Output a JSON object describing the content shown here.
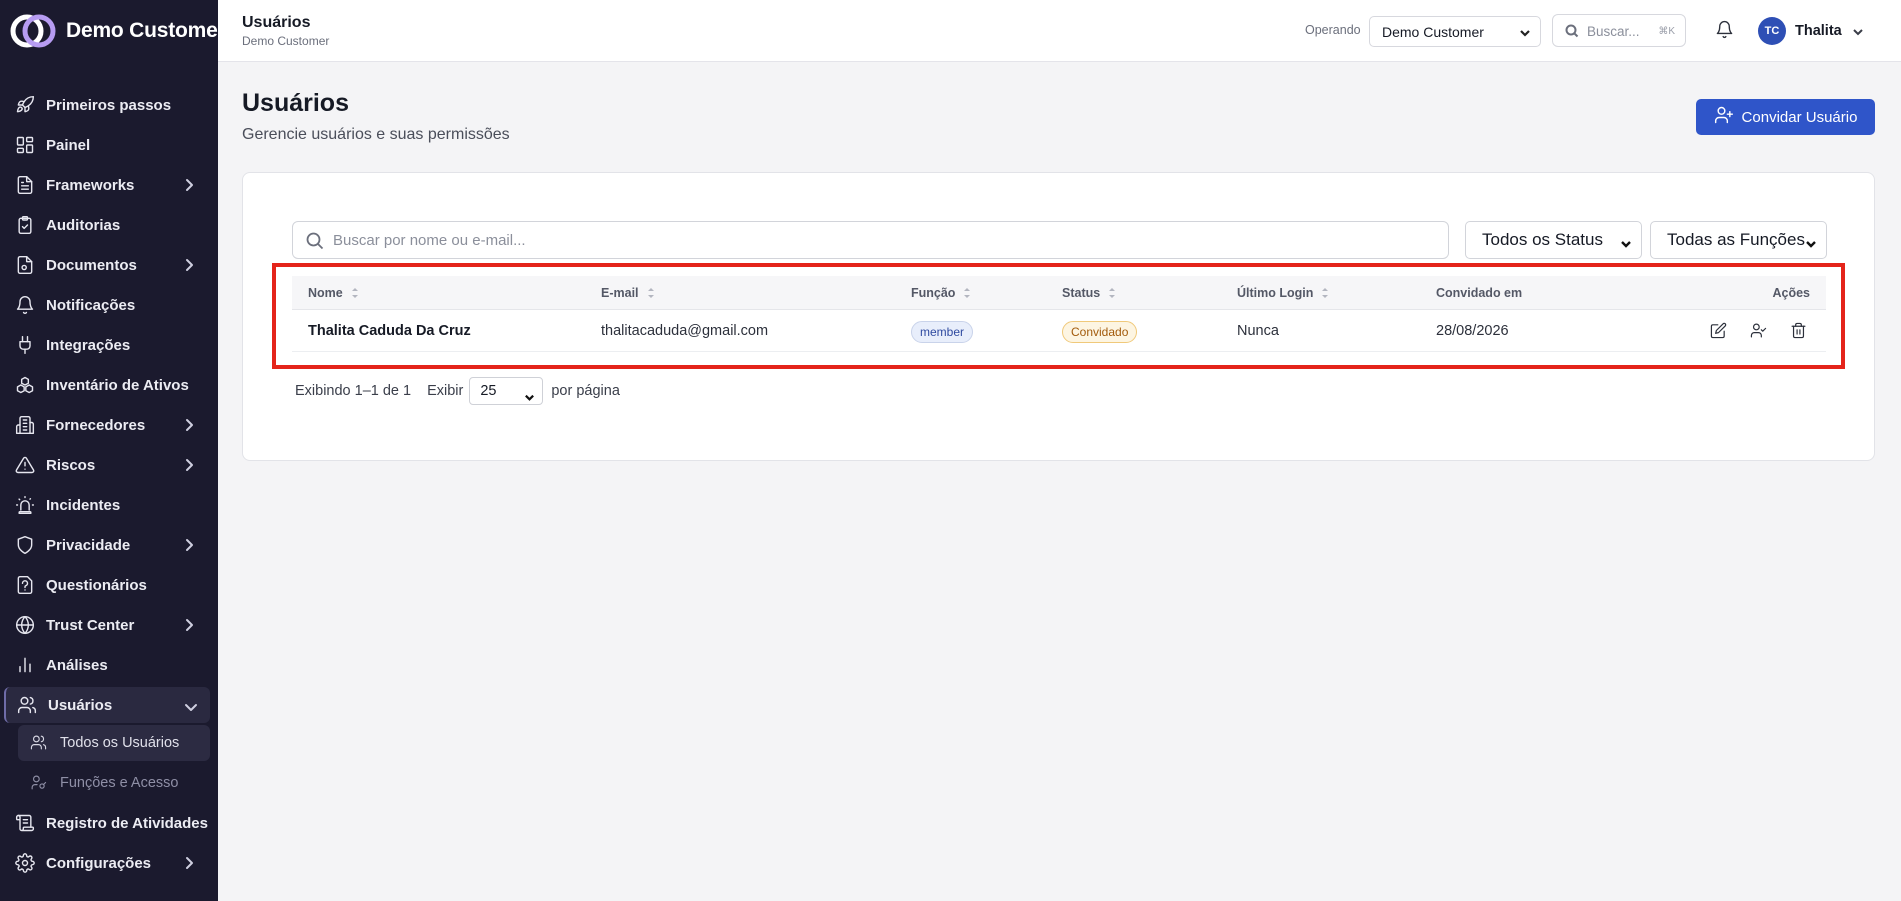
{
  "brand": {
    "name": "Demo Customer"
  },
  "sidebar": {
    "items": [
      {
        "label": "Primeiros passos",
        "icon": "rocket-icon",
        "expandable": false
      },
      {
        "label": "Painel",
        "icon": "dashboard-icon",
        "expandable": false
      },
      {
        "label": "Frameworks",
        "icon": "document-icon",
        "expandable": true
      },
      {
        "label": "Auditorias",
        "icon": "clipboard-check-icon",
        "expandable": false
      },
      {
        "label": "Documentos",
        "icon": "file-icon",
        "expandable": true
      },
      {
        "label": "Notificações",
        "icon": "bell-icon",
        "expandable": false
      },
      {
        "label": "Integrações",
        "icon": "plug-icon",
        "expandable": false
      },
      {
        "label": "Inventário de Ativos",
        "icon": "boxes-icon",
        "expandable": false
      },
      {
        "label": "Fornecedores",
        "icon": "building-icon",
        "expandable": true
      },
      {
        "label": "Riscos",
        "icon": "warning-icon",
        "expandable": true
      },
      {
        "label": "Incidentes",
        "icon": "siren-icon",
        "expandable": false
      },
      {
        "label": "Privacidade",
        "icon": "shield-icon",
        "expandable": true
      },
      {
        "label": "Questionários",
        "icon": "questionnaire-icon",
        "expandable": false
      },
      {
        "label": "Trust Center",
        "icon": "globe-icon",
        "expandable": true
      },
      {
        "label": "Análises",
        "icon": "bar-chart-icon",
        "expandable": false
      },
      {
        "label": "Usuários",
        "icon": "users-icon",
        "expandable": true,
        "expanded": true
      },
      {
        "label": "Registro de Atividades",
        "icon": "log-icon",
        "expandable": false
      },
      {
        "label": "Configurações",
        "icon": "gear-icon",
        "expandable": true
      }
    ],
    "sub_items": [
      {
        "label": "Todos os Usuários",
        "icon": "users-icon"
      },
      {
        "label": "Funções e Acesso",
        "icon": "user-key-icon"
      }
    ]
  },
  "header": {
    "title": "Usuários",
    "subtitle": "Demo Customer",
    "operando_label": "Operando",
    "operando_value": "Demo Customer",
    "search_placeholder": "Buscar...",
    "search_shortcut": "⌘K",
    "user_initials": "TC",
    "user_name": "Thalita"
  },
  "page": {
    "title": "Usuários",
    "subtitle": "Gerencie usuários e suas permissões",
    "invite_label": "Convidar Usuário"
  },
  "filters": {
    "search_placeholder": "Buscar por nome ou e-mail...",
    "status_value": "Todos os Status",
    "role_value": "Todas as Funções"
  },
  "table": {
    "columns": [
      "Nome",
      "E-mail",
      "Função",
      "Status",
      "Último Login",
      "Convidado em",
      "Ações"
    ],
    "rows": [
      {
        "name": "Thalita Caduda Da Cruz",
        "email": "thalitacaduda@gmail.com",
        "role": "member",
        "status": "Convidado",
        "last_login": "Nunca",
        "invited_at": "28/08/2026"
      }
    ]
  },
  "pagination": {
    "summary": "Exibindo 1–1 de 1",
    "show_label": "Exibir",
    "page_size": "25",
    "per_page_label": "por página"
  },
  "colors": {
    "sidebar_bg": "#1b1a2e",
    "accent": "#2f55c9",
    "highlight": "#e4241a",
    "status_invited": "#a25a0b"
  }
}
